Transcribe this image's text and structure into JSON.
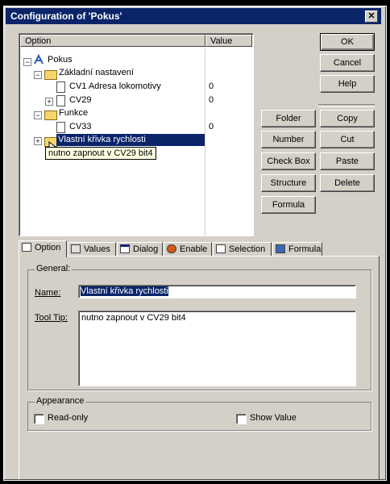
{
  "window": {
    "title": "Configuration of 'Pokus'",
    "close": "✕"
  },
  "tree": {
    "col_option": "Option",
    "col_value": "Value",
    "nodes": [
      {
        "label": "Pokus",
        "value": ""
      },
      {
        "label": "Základní nastavení",
        "value": ""
      },
      {
        "label": "CV1 Adresa lokomotivy",
        "value": "0"
      },
      {
        "label": "CV29",
        "value": "0"
      },
      {
        "label": "Funkce",
        "value": ""
      },
      {
        "label": "CV33",
        "value": "0"
      },
      {
        "label": "Vlastní křivka rychlosti",
        "value": ""
      }
    ],
    "tooltip": "nutno zapnout v CV29 bit4"
  },
  "buttons": {
    "ok": "OK",
    "cancel": "Cancel",
    "help": "Help",
    "folder": "Folder",
    "copy": "Copy",
    "number": "Number",
    "cut": "Cut",
    "checkbox": "Check Box",
    "paste": "Paste",
    "structure": "Structure",
    "delete": "Delete",
    "formula": "Formula"
  },
  "tabs": [
    "Option",
    "Values",
    "Dialog",
    "Enable",
    "Selection",
    "Formula"
  ],
  "general": {
    "group_label": "General:",
    "name_label": "Name:",
    "name_value": "Vlastní křivka rychlosti",
    "tooltip_label": "Tool Tip:",
    "tooltip_value": "nutno zapnout v CV29 bit4"
  },
  "appearance": {
    "group_label": "Appearance",
    "readonly_label": "Read-only",
    "showvalue_label": "Show Value"
  }
}
